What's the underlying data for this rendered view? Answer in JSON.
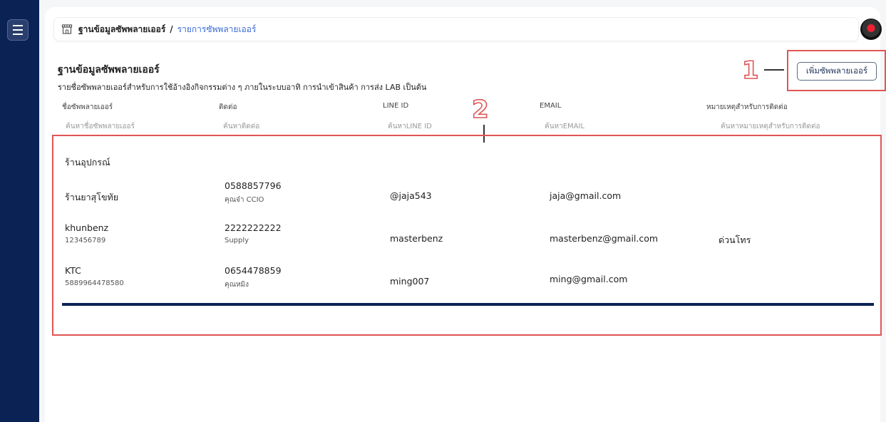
{
  "breadcrumb": {
    "root": "ฐานข้อมูลซัพพลายเออร์",
    "separator": "/",
    "current": "รายการซัพพลายเออร์"
  },
  "page": {
    "title": "ฐานข้อมูลซัพพลายเออร์",
    "subtitle": "รายชื่อซัพพลายเออร์สำหรับการใช้อ้างอิงกิจกรรมต่าง ๆ ภายในระบบอาทิ การนำเข้าสินค้า การส่ง LAB เป็นต้น",
    "add_button": "เพิ่มซัพพลายเออร์"
  },
  "columns": [
    {
      "header": "ชื่อซัพพลายเออร์",
      "filter_placeholder": "ค้นหาชื่อซัพพลายเออร์"
    },
    {
      "header": "ติดต่อ",
      "filter_placeholder": "ค้นหาติดต่อ"
    },
    {
      "header": "LINE ID",
      "filter_placeholder": "ค้นหาLINE ID"
    },
    {
      "header": "EMAIL",
      "filter_placeholder": "ค้นหาEMAIL"
    },
    {
      "header": "หมายเหตุสำหรับการติดต่อ",
      "filter_placeholder": "ค้นหาหมายเหตุสำหรับการติดต่อ"
    }
  ],
  "group": {
    "title": "ร้านอุปกรณ์"
  },
  "rows": [
    {
      "name": "ร้านยาสุโขทัย",
      "name_sub": "",
      "phone": "0588857796",
      "contact": "คุณจ๋า CCIO",
      "line_id": "@jaja543",
      "email": "jaja@gmail.com",
      "note": ""
    },
    {
      "name": "khunbenz",
      "name_sub": "123456789",
      "phone": "2222222222",
      "contact": "Supply",
      "line_id": "masterbenz",
      "email": "masterbenz@gmail.com",
      "note": "ด่วนโทร"
    },
    {
      "name": "KTC",
      "name_sub": "5889964478580",
      "phone": "0654478859",
      "contact": "คุณหมิง",
      "line_id": "ming007",
      "email": "ming@gmail.com",
      "note": ""
    }
  ],
  "callouts": {
    "one": "1",
    "two": "2"
  },
  "icons": {
    "menu": "hamburger-icon",
    "breadcrumb": "store-icon",
    "avatar": "user-avatar"
  },
  "colors": {
    "sidebar": "#0b2354",
    "accent_link": "#3b6bd6",
    "callout": "#e05555",
    "footer_bar": "#0b2354"
  }
}
